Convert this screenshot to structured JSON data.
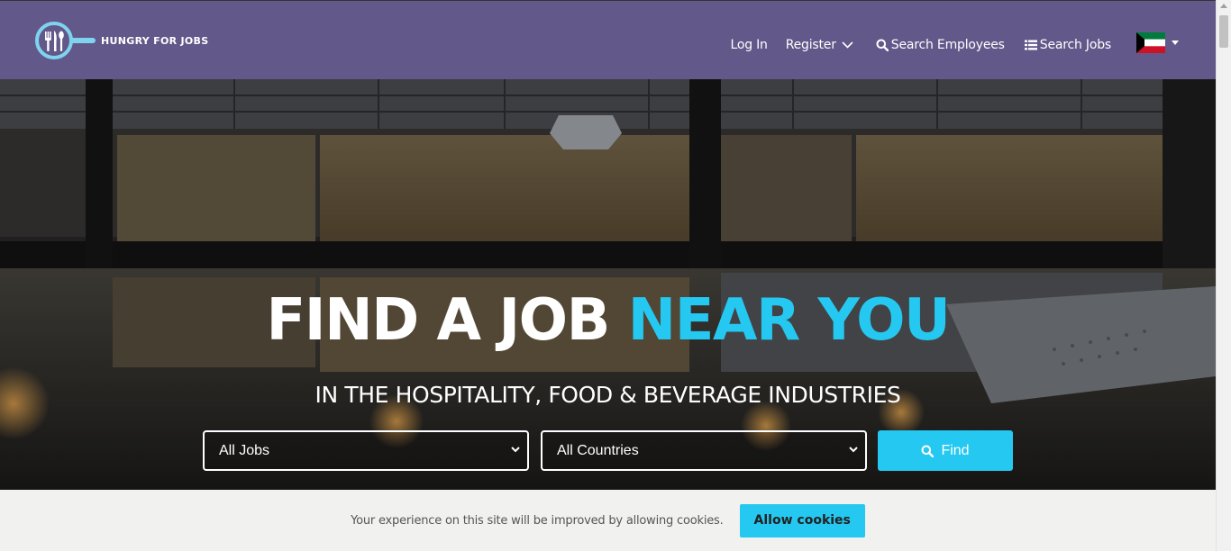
{
  "brand": {
    "name": "HUNGRY FOR JOBS",
    "primary_color": "#62588a",
    "accent_color": "#25c8f0"
  },
  "nav": {
    "login": "Log In",
    "register": "Register",
    "search_employees": "Search Employees",
    "search_jobs": "Search Jobs",
    "language_flag": "kuwait-flag-icon"
  },
  "hero": {
    "title_main": "FIND A JOB ",
    "title_accent": "NEAR YOU",
    "subtitle": "IN THE HOSPITALITY, FOOD & BEVERAGE INDUSTRIES",
    "job_select": {
      "value": "All Jobs"
    },
    "country_select": {
      "value": "All Countries"
    },
    "find_label": "Find"
  },
  "cookie": {
    "message": "Your experience on this site will be improved by allowing cookies.",
    "button": "Allow cookies"
  }
}
